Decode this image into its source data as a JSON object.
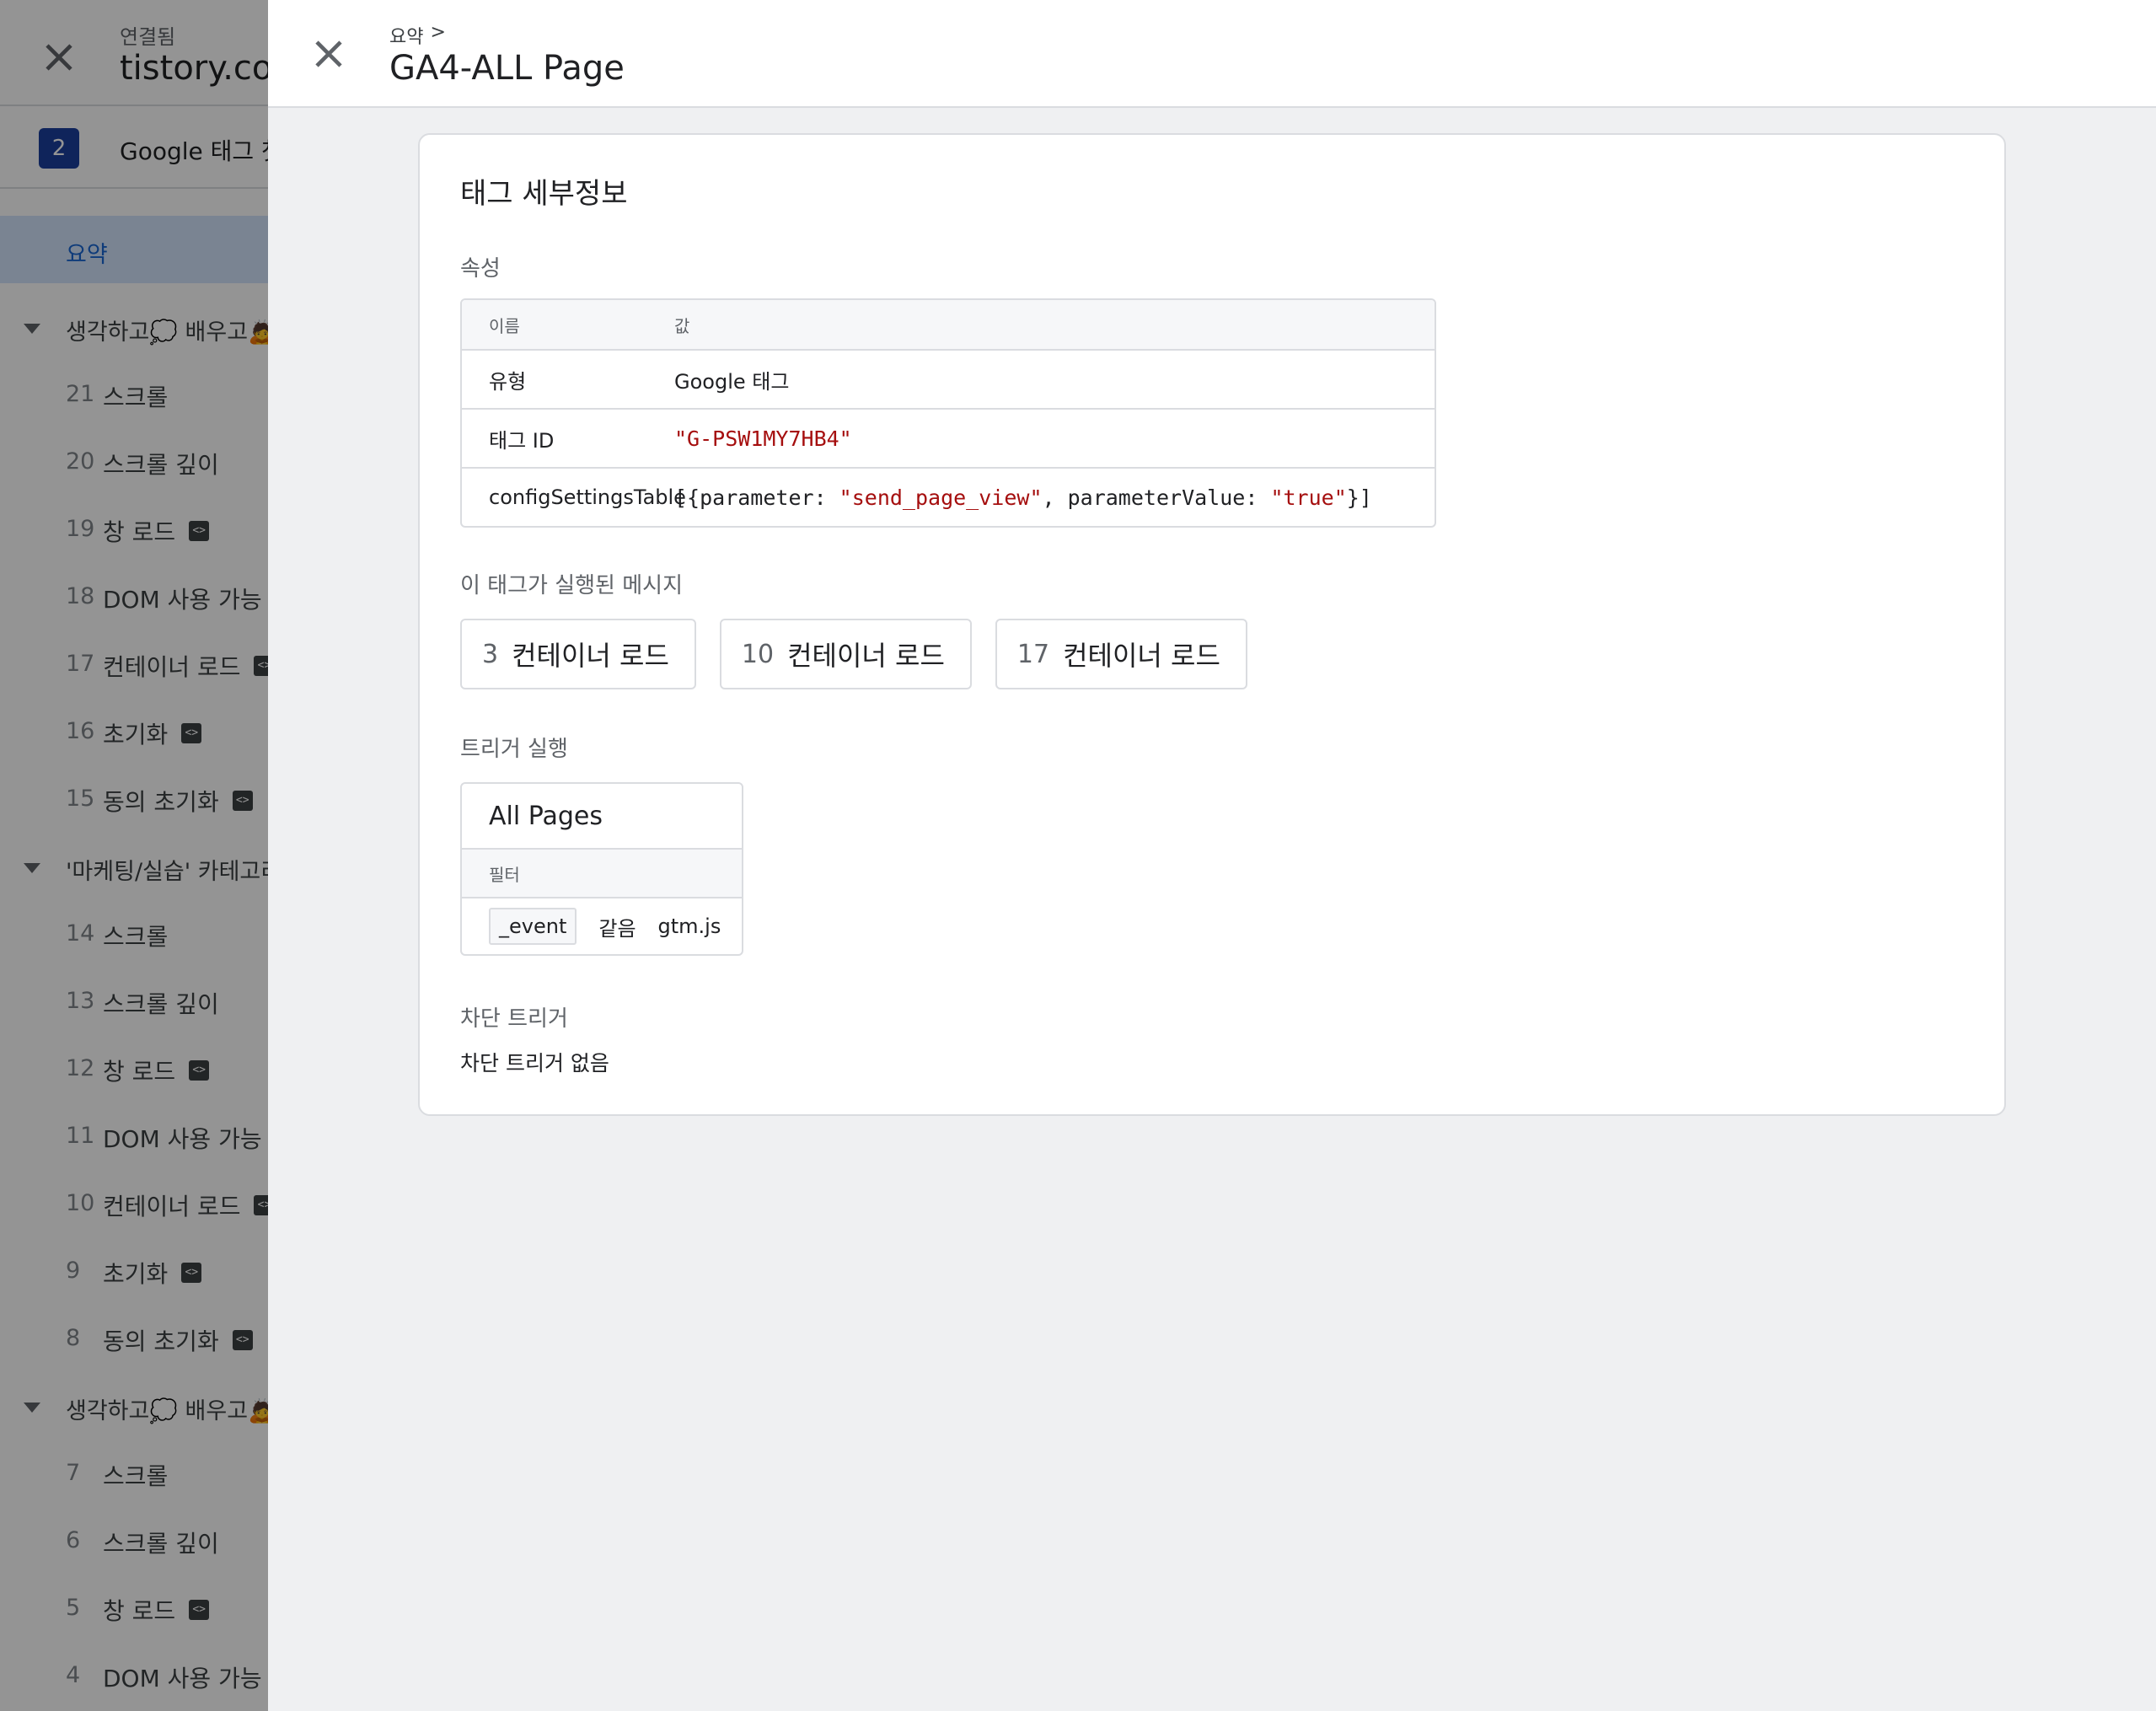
{
  "left_panel": {
    "status": "연결됨",
    "domain": "tistory.com",
    "container_badge": "2",
    "container_name": "Google 태그 첫",
    "summary_label": "요약",
    "groups": [
      {
        "label": "생각하고💭 배우고🙇",
        "items": [
          {
            "num": "21",
            "name": "스크롤",
            "code": false
          },
          {
            "num": "20",
            "name": "스크롤 깊이",
            "code": false
          },
          {
            "num": "19",
            "name": "창 로드",
            "code": true
          },
          {
            "num": "18",
            "name": "DOM 사용 가능",
            "code": false
          },
          {
            "num": "17",
            "name": "컨테이너 로드",
            "code": true
          },
          {
            "num": "16",
            "name": "초기화",
            "code": true
          },
          {
            "num": "15",
            "name": "동의 초기화",
            "code": true
          }
        ]
      },
      {
        "label": "'마케팅/실습' 카테고리",
        "items": [
          {
            "num": "14",
            "name": "스크롤",
            "code": false
          },
          {
            "num": "13",
            "name": "스크롤 깊이",
            "code": false
          },
          {
            "num": "12",
            "name": "창 로드",
            "code": true
          },
          {
            "num": "11",
            "name": "DOM 사용 가능",
            "code": false
          },
          {
            "num": "10",
            "name": "컨테이너 로드",
            "code": true
          },
          {
            "num": "9",
            "name": "초기화",
            "code": true
          },
          {
            "num": "8",
            "name": "동의 초기화",
            "code": true
          }
        ]
      },
      {
        "label": "생각하고💭 배우고🙇",
        "items": [
          {
            "num": "7",
            "name": "스크롤",
            "code": false
          },
          {
            "num": "6",
            "name": "스크롤 깊이",
            "code": false
          },
          {
            "num": "5",
            "name": "창 로드",
            "code": true
          },
          {
            "num": "4",
            "name": "DOM 사용 가능",
            "code": false
          }
        ]
      }
    ]
  },
  "header": {
    "breadcrumb": "요약",
    "breadcrumb_sep": ">",
    "title": "GA4-ALL Page"
  },
  "card": {
    "title": "태그 세부정보",
    "properties_label": "속성",
    "table": {
      "col_name": "이름",
      "col_value": "값",
      "type_name": "유형",
      "type_value": "Google 태그",
      "tagid_name": "태그 ID",
      "tagid_value": "\"G-PSW1MY7HB4\"",
      "config_name": "configSettingsTable",
      "config_p1": "[{parameter: ",
      "config_s1": "\"send_page_view\"",
      "config_p2": ", parameterValue: ",
      "config_s2": "\"true\"",
      "config_p3": "}]"
    },
    "messages_label": "이 태그가 실행된 메시지",
    "messages": [
      {
        "num": "3",
        "name": "컨테이너 로드"
      },
      {
        "num": "10",
        "name": "컨테이너 로드"
      },
      {
        "num": "17",
        "name": "컨테이너 로드"
      }
    ],
    "firing_label": "트리거 실행",
    "trigger": {
      "name": "All Pages",
      "filter_label": "필터",
      "filter_var": "_event",
      "filter_op": "같음",
      "filter_val": "gtm.js"
    },
    "blocking_label": "차단 트리거",
    "blocking_empty": "차단 트리거 없음"
  },
  "icons": {
    "close": "close-icon",
    "code": "code-icon",
    "caret": "caret-down-icon"
  },
  "colors": {
    "accent": "#1967d2",
    "badge": "#1a3e9e",
    "string": "#a50e0e",
    "background": "#eff0f2"
  }
}
